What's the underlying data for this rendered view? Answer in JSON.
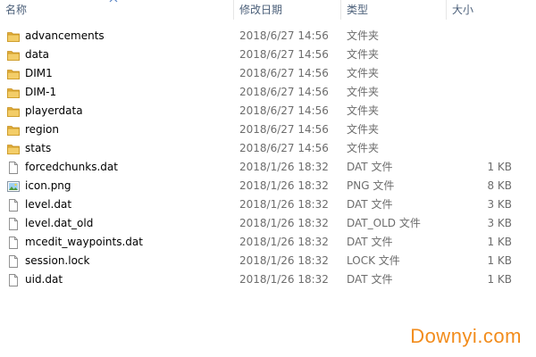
{
  "columns": {
    "name": "名称",
    "date": "修改日期",
    "type": "类型",
    "size": "大小"
  },
  "sort": {
    "column": "name",
    "direction": "ascending"
  },
  "files": [
    {
      "name": "advancements",
      "date": "2018/6/27 14:56",
      "type": "文件夹",
      "size": "",
      "icon": "folder-icon"
    },
    {
      "name": "data",
      "date": "2018/6/27 14:56",
      "type": "文件夹",
      "size": "",
      "icon": "folder-icon"
    },
    {
      "name": "DIM1",
      "date": "2018/6/27 14:56",
      "type": "文件夹",
      "size": "",
      "icon": "folder-icon"
    },
    {
      "name": "DIM-1",
      "date": "2018/6/27 14:56",
      "type": "文件夹",
      "size": "",
      "icon": "folder-icon"
    },
    {
      "name": "playerdata",
      "date": "2018/6/27 14:56",
      "type": "文件夹",
      "size": "",
      "icon": "folder-icon"
    },
    {
      "name": "region",
      "date": "2018/6/27 14:56",
      "type": "文件夹",
      "size": "",
      "icon": "folder-icon"
    },
    {
      "name": "stats",
      "date": "2018/6/27 14:56",
      "type": "文件夹",
      "size": "",
      "icon": "folder-icon"
    },
    {
      "name": "forcedchunks.dat",
      "date": "2018/1/26 18:32",
      "type": "DAT 文件",
      "size": "1 KB",
      "icon": "file-icon"
    },
    {
      "name": "icon.png",
      "date": "2018/1/26 18:32",
      "type": "PNG 文件",
      "size": "8 KB",
      "icon": "image-file-icon"
    },
    {
      "name": "level.dat",
      "date": "2018/1/26 18:32",
      "type": "DAT 文件",
      "size": "3 KB",
      "icon": "file-icon"
    },
    {
      "name": "level.dat_old",
      "date": "2018/1/26 18:32",
      "type": "DAT_OLD 文件",
      "size": "3 KB",
      "icon": "file-icon"
    },
    {
      "name": "mcedit_waypoints.dat",
      "date": "2018/1/26 18:32",
      "type": "DAT 文件",
      "size": "1 KB",
      "icon": "file-icon"
    },
    {
      "name": "session.lock",
      "date": "2018/1/26 18:32",
      "type": "LOCK 文件",
      "size": "1 KB",
      "icon": "file-icon"
    },
    {
      "name": "uid.dat",
      "date": "2018/1/26 18:32",
      "type": "DAT 文件",
      "size": "1 KB",
      "icon": "file-icon"
    }
  ],
  "watermark": "Downyi.com",
  "colors": {
    "header_text": "#4c607a",
    "secondary_text": "#6d6d6d",
    "folder": "#e8b94a",
    "watermark": "#f28c1c"
  }
}
